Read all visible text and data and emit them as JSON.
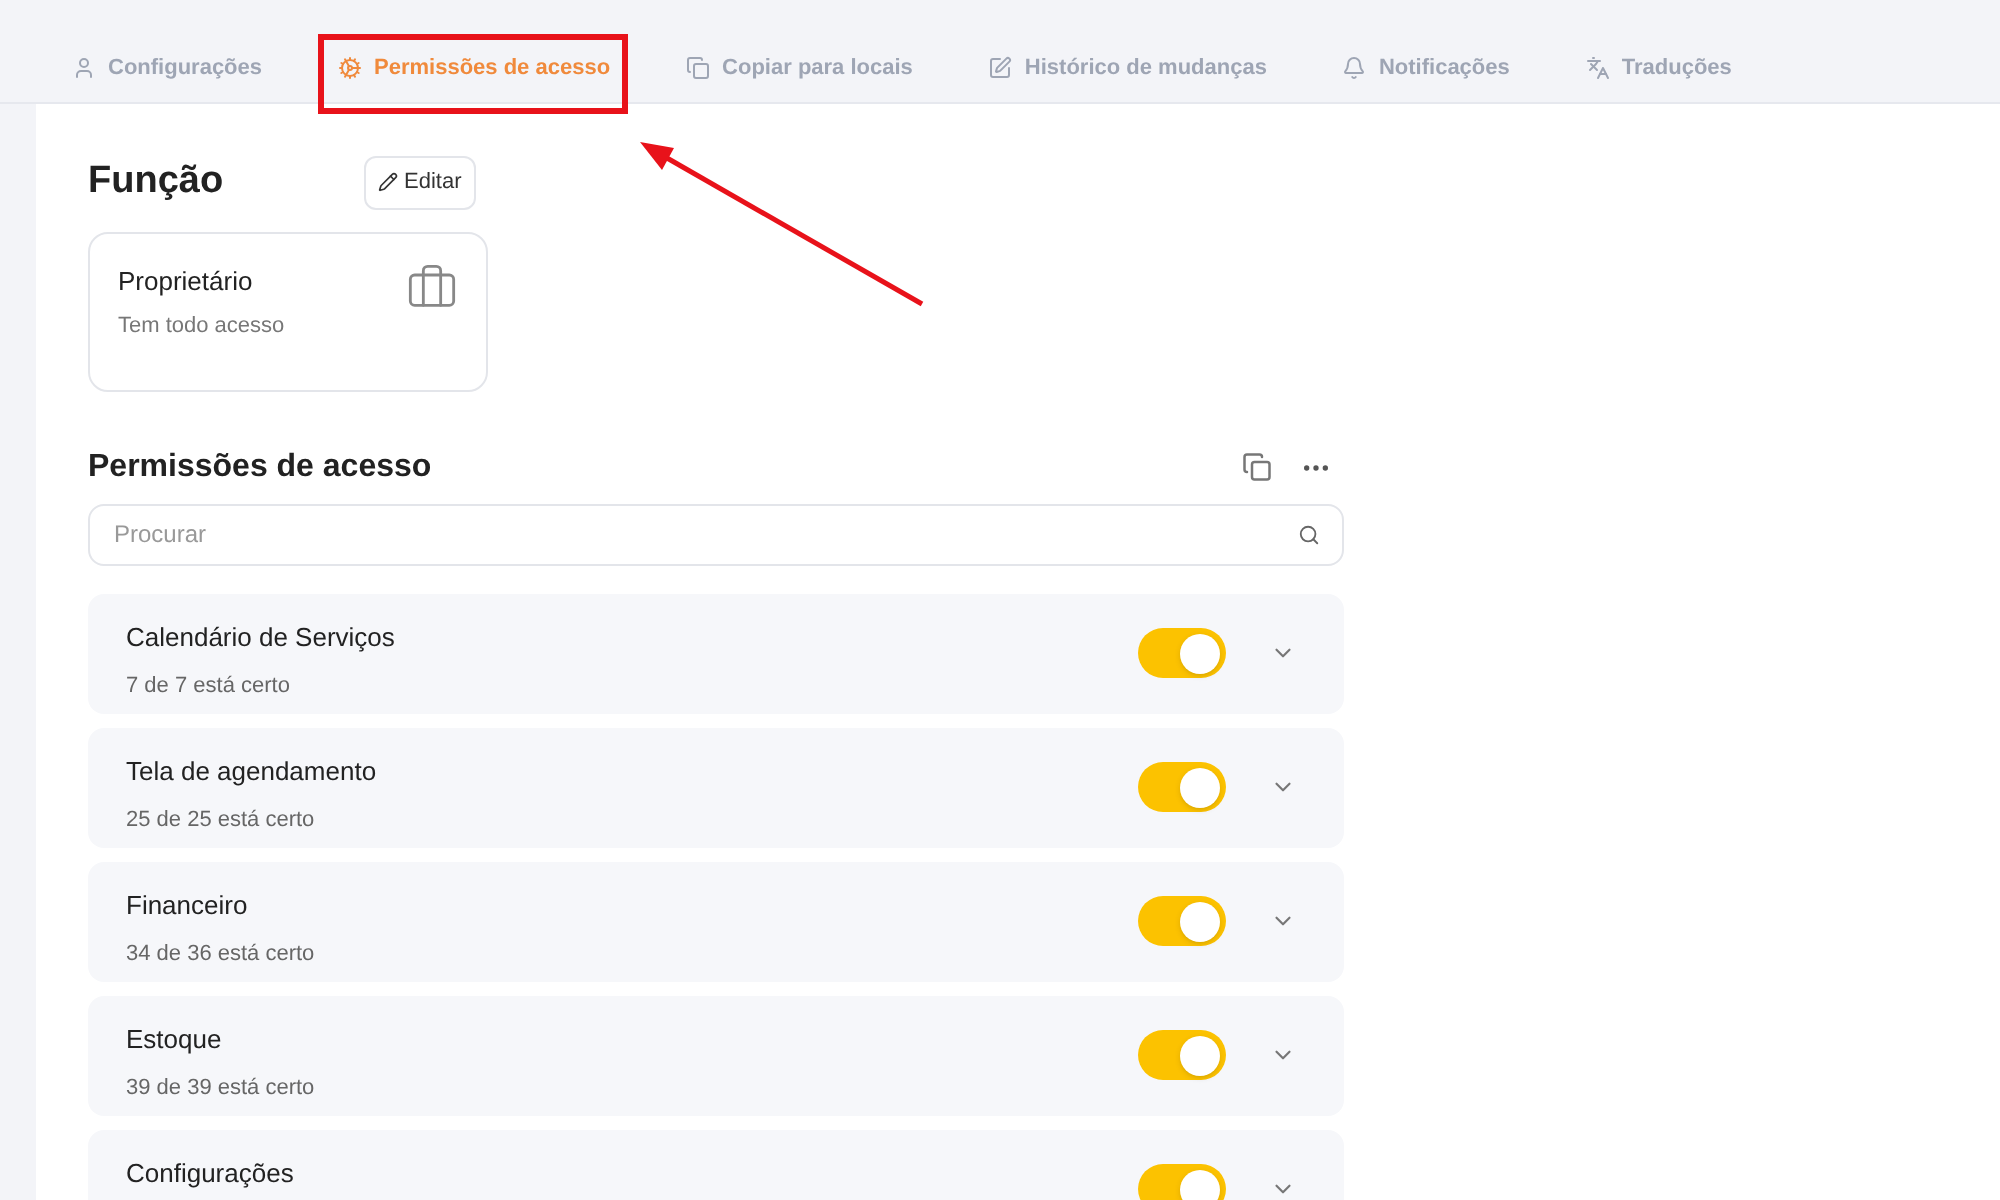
{
  "tabs": [
    {
      "label": "Configurações",
      "kind": "user",
      "selected": false
    },
    {
      "label": "Permissões de acesso",
      "kind": "gears",
      "selected": true
    },
    {
      "label": "Copiar para locais",
      "kind": "copy",
      "selected": false
    },
    {
      "label": "Histórico de mudanças",
      "kind": "edit",
      "selected": false
    },
    {
      "label": "Notificações",
      "kind": "bell",
      "selected": false
    },
    {
      "label": "Traduções",
      "kind": "translate",
      "selected": false
    }
  ],
  "role": {
    "heading": "Função",
    "edit_button": "Editar",
    "card": {
      "title": "Proprietário",
      "subtitle": "Tem todo acesso"
    }
  },
  "permissions": {
    "heading": "Permissões de acesso",
    "search": {
      "placeholder": "Procurar"
    },
    "items": [
      {
        "title": "Calendário de Serviços",
        "summary": "7 de 7 está certo",
        "on": true
      },
      {
        "title": "Tela de agendamento",
        "summary": "25 de 25 está certo",
        "on": true
      },
      {
        "title": "Financeiro",
        "summary": "34 de 36 está certo",
        "on": true
      },
      {
        "title": "Estoque",
        "summary": "39 de 39 está certo",
        "on": true
      },
      {
        "title": "Configurações",
        "on": true
      }
    ]
  }
}
